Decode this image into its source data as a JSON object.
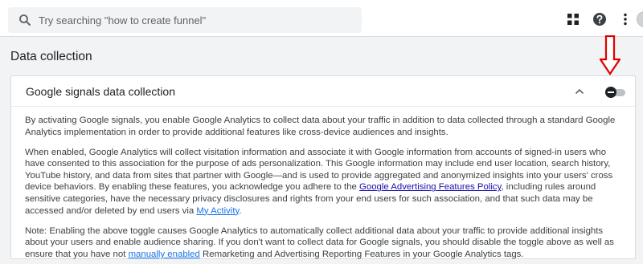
{
  "search": {
    "placeholder": "Try searching \"how to create funnel\""
  },
  "page": {
    "section_title": "Data collection"
  },
  "card": {
    "title": "Google signals data collection",
    "toggle_state": "off",
    "p1": "By activating Google signals, you enable Google Analytics to collect data about your traffic in addition to data collected through a standard Google Analytics implementation in order to provide additional features like cross-device audiences and insights.",
    "p2_before": "When enabled, Google Analytics will collect visitation information and associate it with Google information from accounts of signed-in users who have consented to this association for the purpose of ads personalization. This Google information may include end user location, search history, YouTube history, and data from sites that partner with Google—and is used to provide aggregated and anonymized insights into your users' cross device behaviors. By enabling these features, you acknowledge you adhere to the ",
    "p2_link1": "Google Advertising Features Policy",
    "p2_middle": ", including rules around sensitive categories, have the necessary privacy disclosures and rights from your end users for such association, and that such data may be accessed and/or deleted by end users via ",
    "p2_link2": "My Activity",
    "p2_after": ".",
    "p3_before": "Note: Enabling the above toggle causes Google Analytics to automatically collect additional data about your traffic to provide additional insights about your users and enable audience sharing. If you don't want to collect data for Google signals, you should disable the toggle above as well as ensure that you have not ",
    "p3_link": "manually enabled",
    "p3_after": " Remarketing and Advertising Reporting Features in your Google Analytics tags."
  },
  "icons": {
    "search": "search-icon",
    "apps": "apps-grid-icon",
    "help": "help-icon",
    "more": "more-vert-icon",
    "collapse": "chevron-up-icon",
    "annotation": "red-down-arrow-icon"
  },
  "colors": {
    "accent_link": "#1a73e8",
    "annotation_arrow": "#e00000",
    "toggle_thumb": "#202124"
  }
}
